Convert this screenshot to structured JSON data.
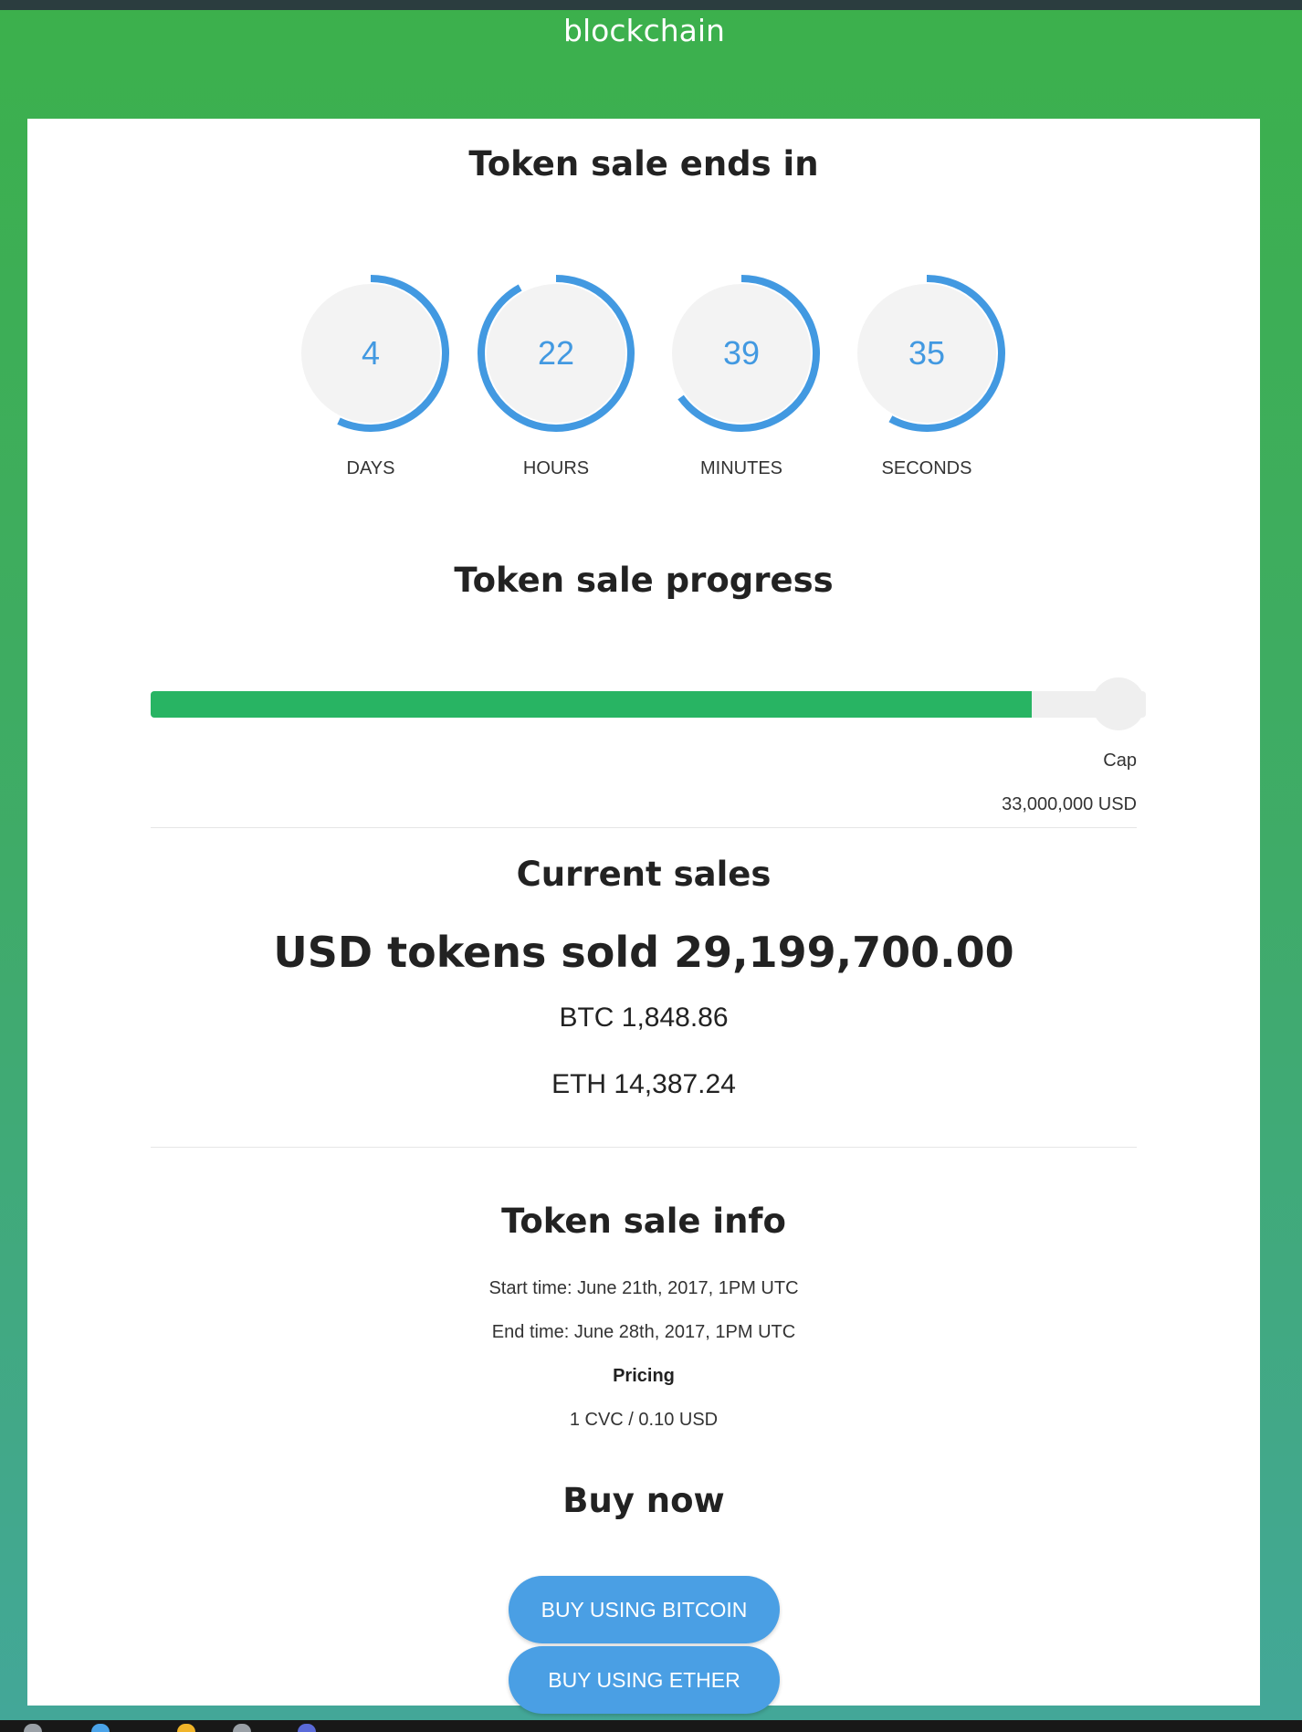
{
  "header": {
    "brand": "blockchain"
  },
  "countdown": {
    "title": "Token sale ends in",
    "units": [
      {
        "value": "4",
        "label": "DAYS",
        "fraction": 0.57
      },
      {
        "value": "22",
        "label": "HOURS",
        "fraction": 0.92
      },
      {
        "value": "39",
        "label": "MINUTES",
        "fraction": 0.65
      },
      {
        "value": "35",
        "label": "SECONDS",
        "fraction": 0.58
      }
    ],
    "ring_color": "#4299e1",
    "ring_bg_color": "#f3f3f3"
  },
  "progress": {
    "title": "Token sale progress",
    "percent": 88.5,
    "fill_color": "#28b463",
    "cap_label": "Cap",
    "cap_value": "33,000,000 USD"
  },
  "sales": {
    "title": "Current sales",
    "usd": "USD tokens sold 29,199,700.00",
    "btc": "BTC 1,848.86",
    "eth": "ETH 14,387.24"
  },
  "info": {
    "title": "Token sale info",
    "start": "Start time: June 21th, 2017, 1PM UTC",
    "end": "End time: June 28th, 2017, 1PM UTC",
    "pricing_label": "Pricing",
    "pricing_value": "1 CVC / 0.10 USD"
  },
  "buy": {
    "title": "Buy now",
    "bitcoin_label": "BUY USING BITCOIN",
    "ether_label": "BUY USING ETHER",
    "button_color": "#4a9fe4"
  }
}
